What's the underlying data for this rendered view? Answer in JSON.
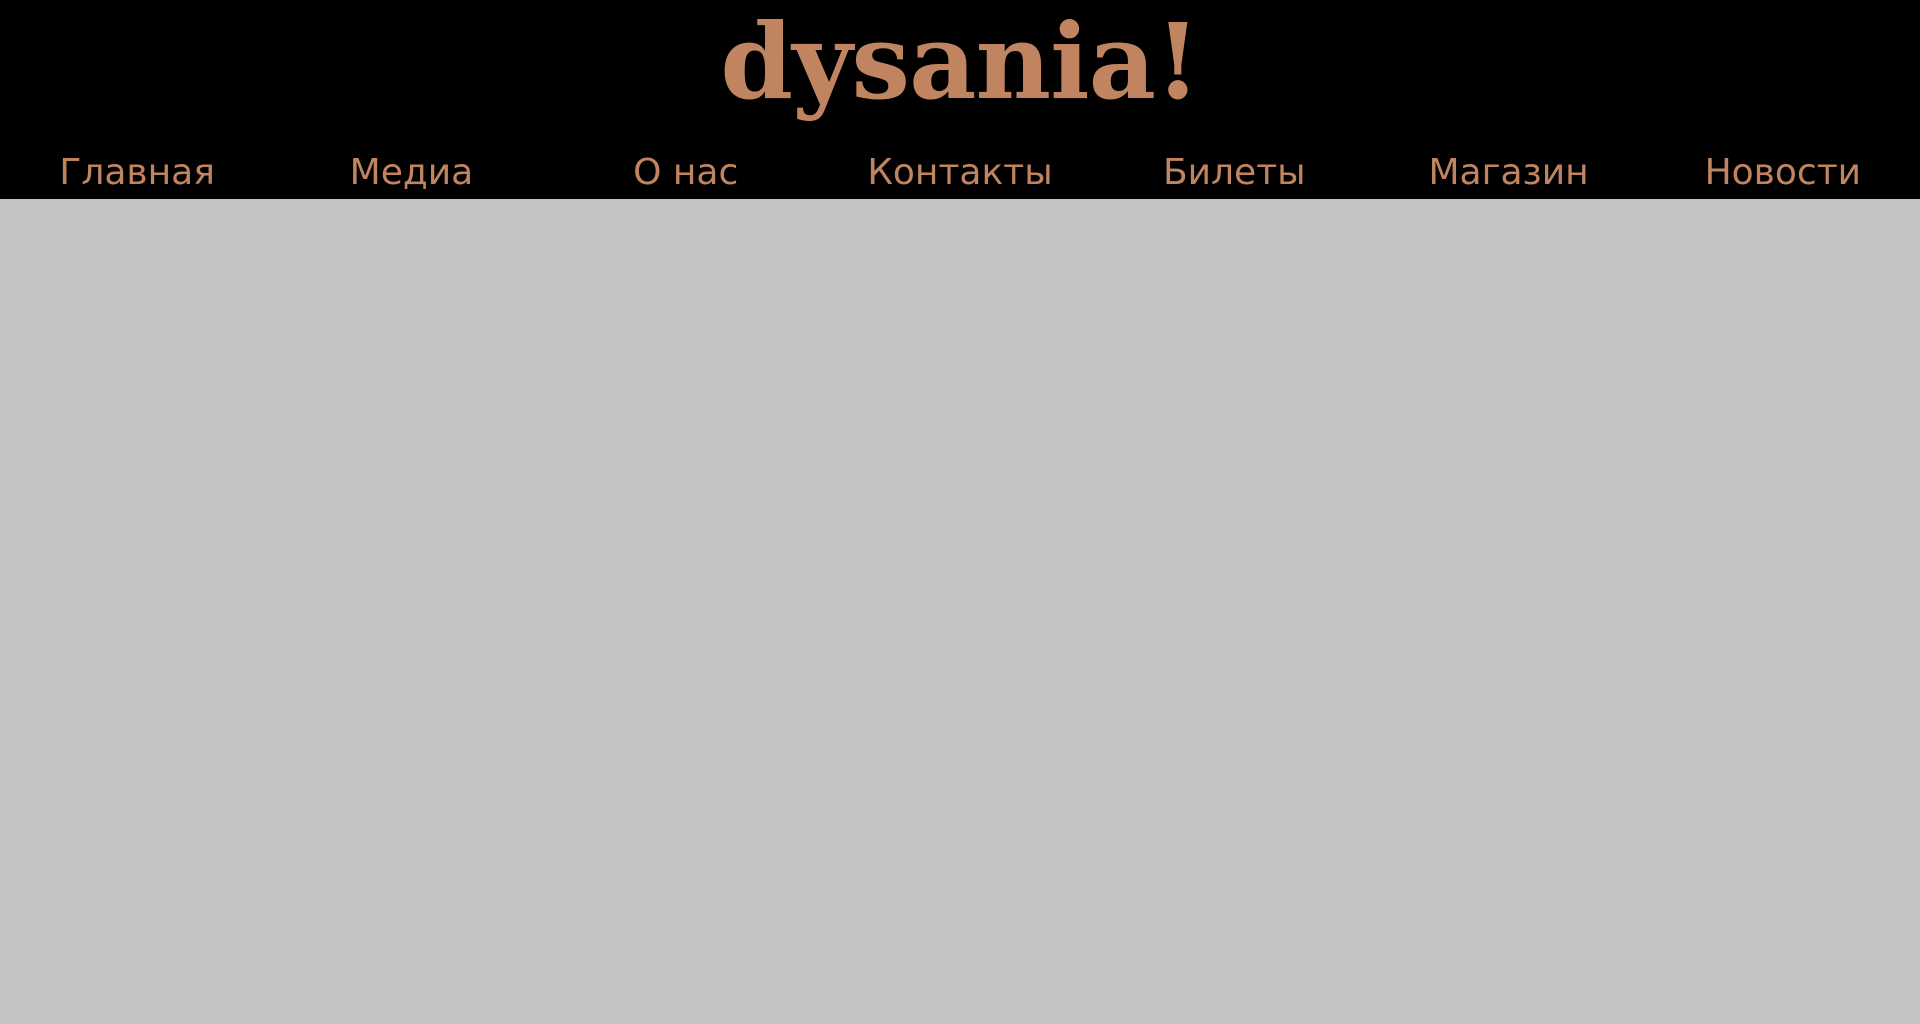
{
  "header": {
    "logo_text": "dysania!"
  },
  "nav": {
    "items": [
      {
        "label": "Главная"
      },
      {
        "label": "Медиа"
      },
      {
        "label": "О нас"
      },
      {
        "label": "Контакты"
      },
      {
        "label": "Билеты"
      },
      {
        "label": "Магазин"
      },
      {
        "label": "Новости"
      }
    ]
  },
  "colors": {
    "header_background": "#000000",
    "accent": "#c08560",
    "page_background": "#c4c4c4"
  }
}
